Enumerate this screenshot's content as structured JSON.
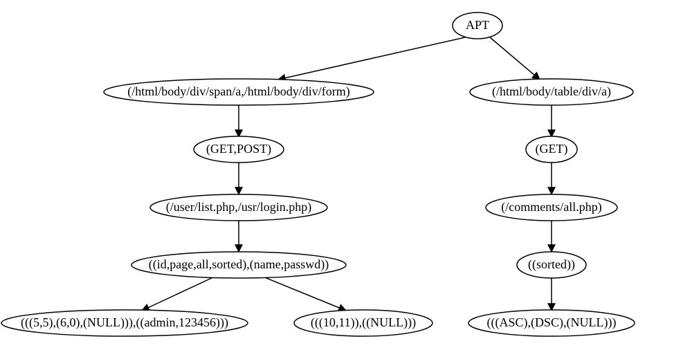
{
  "diagram": {
    "title": "APT",
    "nodes": {
      "root": "APT",
      "left_l2": "(/html/body/div/span/a,/html/body/div/form)",
      "right_l2": "(/html/body/table/div/a)",
      "left_l3": "(GET,POST)",
      "right_l3": "(GET)",
      "left_l4": "(/user/list.php,/usr/login.php)",
      "right_l4": "(/comments/all.php)",
      "left_l5": "((id,page,all,sorted),(name,passwd))",
      "right_l5": "((sorted))",
      "leaf_a": "(((5,5),(6,0),(NULL))),((admin,123456)))",
      "leaf_b": "(((10,11)),((NULL)))",
      "leaf_c": "(((ASC),(DSC),(NULL)))"
    }
  }
}
